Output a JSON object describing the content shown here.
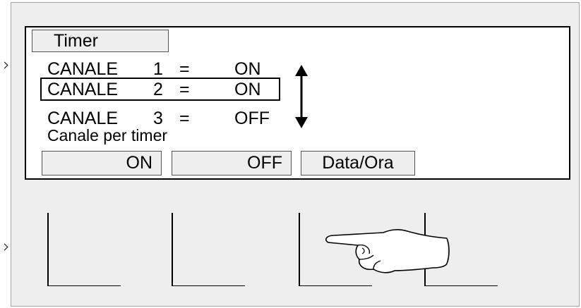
{
  "display": {
    "tab_label": "Timer",
    "channels": [
      {
        "name": "CANALE",
        "number": "1",
        "equals": "=",
        "state": "ON",
        "selected": false
      },
      {
        "name": "CANALE",
        "number": "2",
        "equals": "=",
        "state": "ON",
        "selected": true
      },
      {
        "name": "CANALE",
        "number": "3",
        "equals": "=",
        "state": "OFF",
        "selected": false
      }
    ],
    "hint": "Canale per timer",
    "softkeys": [
      "ON",
      "OFF",
      "Data/Ora"
    ]
  },
  "hardware_keys": [
    "key-1",
    "key-2",
    "key-3",
    "key-4"
  ],
  "icons": {
    "scroll": "up-down-arrow-icon",
    "pointer": "pointing-hand-icon"
  },
  "colors": {
    "panel_background": "#eeeeee",
    "screen_background": "#ffffff",
    "line": "#000000"
  }
}
